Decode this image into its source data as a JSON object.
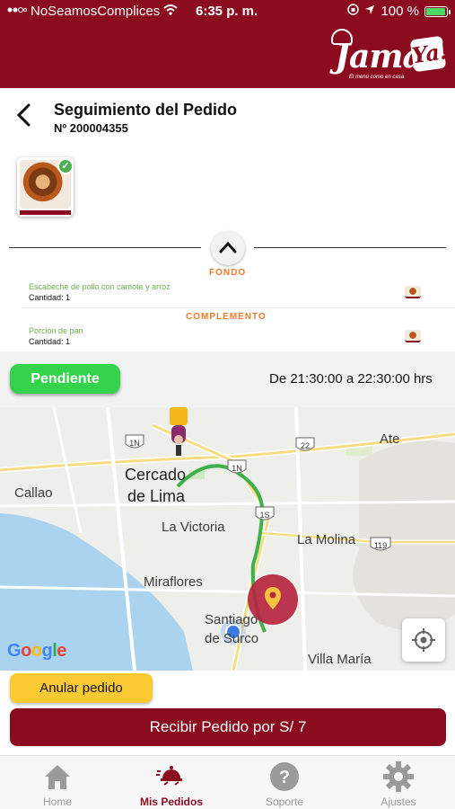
{
  "status_bar": {
    "carrier": "NoSeamosComplices",
    "time": "6:35 p. m.",
    "battery": "100 %",
    "battery_level": 1.0
  },
  "brand": {
    "logo_text": "Jama",
    "logo_ya": "Ya!",
    "tagline": "El menú como en casa",
    "primary_color": "#8b0c1e"
  },
  "page": {
    "title": "Seguimiento del Pedido",
    "order_number": "Nº 200004355"
  },
  "order": {
    "sections": [
      {
        "label": "FONDO",
        "item": "Escabeche de pollo con camote y arroz",
        "quantity": "Cantidad: 1"
      },
      {
        "label": "COMPLEMENTO",
        "item": "Porción de pan",
        "quantity": "Cantidad: 1"
      }
    ]
  },
  "status": {
    "badge": "Pendiente",
    "badge_color": "#35d24c",
    "schedule": "De 21:30:00 a  22:30:00 hrs"
  },
  "map": {
    "labels": {
      "cercado": "Cercado",
      "de_lima": "de Lima",
      "callao": "Callao",
      "la_victoria": "La Victoria",
      "la_molina": "La Molina",
      "miraflores": "Miraflores",
      "santiago": "Santiago",
      "de_surco": "de Surco",
      "villa_maria": "Villa María",
      "ate": "Ate"
    },
    "shields": [
      "1N",
      "1N",
      "22",
      "1S",
      "119"
    ],
    "google": "Google",
    "route_color": "#3fb04a",
    "destination_color": "#b5263f"
  },
  "actions": {
    "cancel": "Anular pedido",
    "receive": "Recibir Pedido por S/ 7"
  },
  "tabs": [
    {
      "label": "Home",
      "icon": "home-icon"
    },
    {
      "label": "Mis Pedidos",
      "icon": "delivery-icon",
      "active": true
    },
    {
      "label": "Soporte",
      "icon": "help-icon"
    },
    {
      "label": "Ajustes",
      "icon": "gear-icon"
    }
  ]
}
